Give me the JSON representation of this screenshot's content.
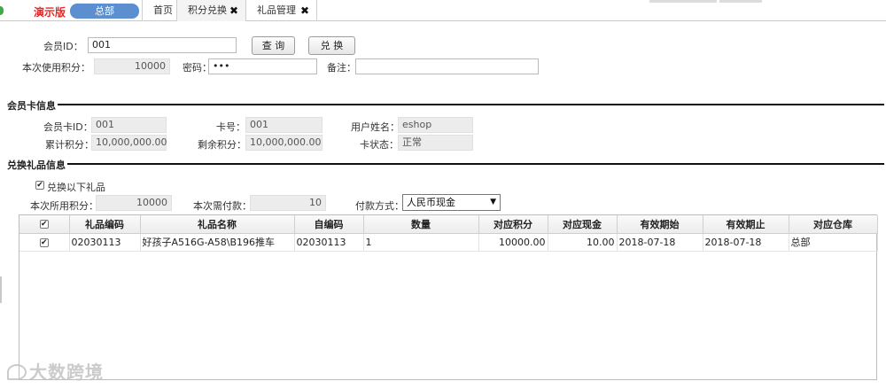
{
  "header": {
    "demo_label": "演示版",
    "store_name": "总部",
    "tabs": [
      {
        "label": "首页",
        "closable": false
      },
      {
        "label": "积分兑换",
        "closable": true
      },
      {
        "label": "礼品管理",
        "closable": true
      }
    ],
    "close_glyph": "✖"
  },
  "query": {
    "member_id_label": "会员ID：",
    "member_id_value": "001",
    "query_button": "查 询",
    "exchange_button": "兑 换",
    "used_points_label": "本次使用积分：",
    "used_points_value": "10000",
    "password_label": "密码：",
    "password_value": "•••",
    "remark_label": "备注：",
    "remark_value": ""
  },
  "member_card": {
    "section_title": "会员卡信息",
    "card_id_label": "会员卡ID：",
    "card_id_value": "001",
    "card_no_label": "卡号：",
    "card_no_value": "001",
    "user_name_label": "用户姓名：",
    "user_name_value": "eshop",
    "total_points_label": "累计积分：",
    "total_points_value": "10,000,000.00",
    "remaining_points_label": "剩余积分：",
    "remaining_points_value": "10,000,000.00",
    "card_status_label": "卡状态：",
    "card_status_value": "正常"
  },
  "gift_exchange": {
    "section_title": "兑换礼品信息",
    "exchange_checkbox_label": "兑换以下礼品",
    "points_used_label": "本次所用积分：",
    "points_used_value": "10000",
    "amount_due_label": "本次需付款：",
    "amount_due_value": "10",
    "payment_label": "付款方式：",
    "payment_selected": "人民币现金",
    "check_glyph": "✔"
  },
  "gift_table": {
    "columns": [
      "礼品编码",
      "礼品名称",
      "自编码",
      "数量",
      "对应积分",
      "对应现金",
      "有效期始",
      "有效期止",
      "对应仓库"
    ],
    "rows": [
      {
        "checked": true,
        "gift_code": "02030113",
        "gift_name": "好孩子A516G-A58\\B196推车",
        "self_code": "02030113",
        "quantity": "1",
        "points": "10000.00",
        "cash": "10.00",
        "valid_from": "2018-07-18",
        "valid_to": "2018-07-18",
        "warehouse": "总部"
      }
    ]
  },
  "watermark": {
    "text": "大数跨境"
  },
  "colors": {
    "demo_red": "#e12b2b",
    "store_pill_blue": "#5b8fd0",
    "logo_green": "#41a947"
  }
}
